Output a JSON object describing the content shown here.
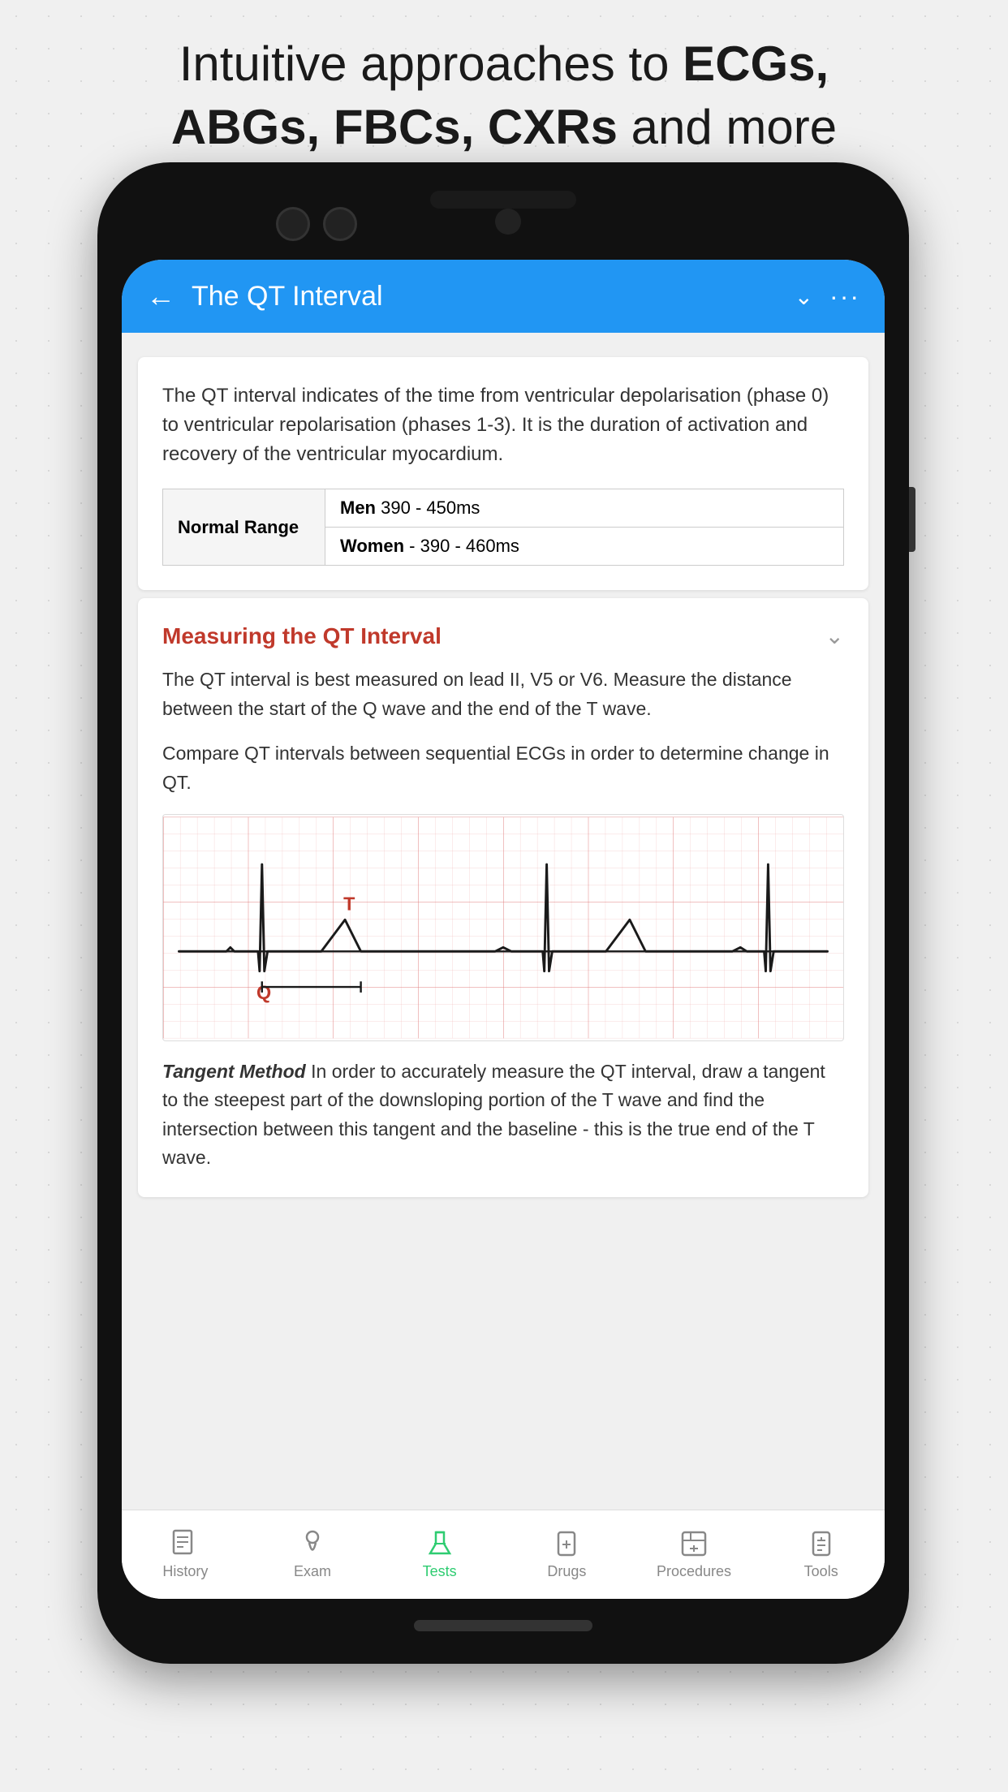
{
  "page": {
    "top_heading_line1": "Intuitive approaches to",
    "top_heading_bold1": "ECGs,",
    "top_heading_line2": "",
    "top_heading_bold2": "ABGs, FBCs, CXRs",
    "top_heading_end": "and more"
  },
  "header": {
    "back_icon": "←",
    "title": "The QT Interval",
    "chevron_icon": "⌄",
    "more_icon": "···"
  },
  "intro": {
    "text": "The QT interval indicates of the time from ventricular depolarisation (phase 0) to ventricular repolarisation (phases 1-3). It is the duration of activation and recovery of the ventricular myocardium."
  },
  "normal_range": {
    "label": "Normal Range",
    "men_label": "Men",
    "men_range": "390 - 450ms",
    "women_label": "Women",
    "women_separator": " - ",
    "women_range": "390 - 460ms"
  },
  "section": {
    "title": "Measuring the QT Interval",
    "chevron": "⌄",
    "para1": "The QT interval is best measured on lead II, V5 or V6. Measure the distance between the start of the Q wave and the end of the T wave.",
    "para2": "Compare QT intervals between sequential ECGs in order to determine change in QT.",
    "ecg_q_label": "Q",
    "ecg_t_label": "T",
    "tangent_bold": "Tangent Method",
    "tangent_text": "  In order to accurately measure the QT interval, draw a tangent to the steepest part of the downsloping portion of the T wave and find the intersection between this tangent and the baseline - this is the true end of the T wave."
  },
  "bottom_nav": {
    "items": [
      {
        "id": "history",
        "label": "History",
        "icon": "📋",
        "active": false
      },
      {
        "id": "exam",
        "label": "Exam",
        "icon": "🩺",
        "active": false
      },
      {
        "id": "tests",
        "label": "Tests",
        "icon": "🧪",
        "active": true
      },
      {
        "id": "drugs",
        "label": "Drugs",
        "icon": "💊",
        "active": false
      },
      {
        "id": "procedures",
        "label": "Procedures",
        "icon": "🔬",
        "active": false
      },
      {
        "id": "tools",
        "label": "Tools",
        "icon": "🧰",
        "active": false
      }
    ]
  }
}
